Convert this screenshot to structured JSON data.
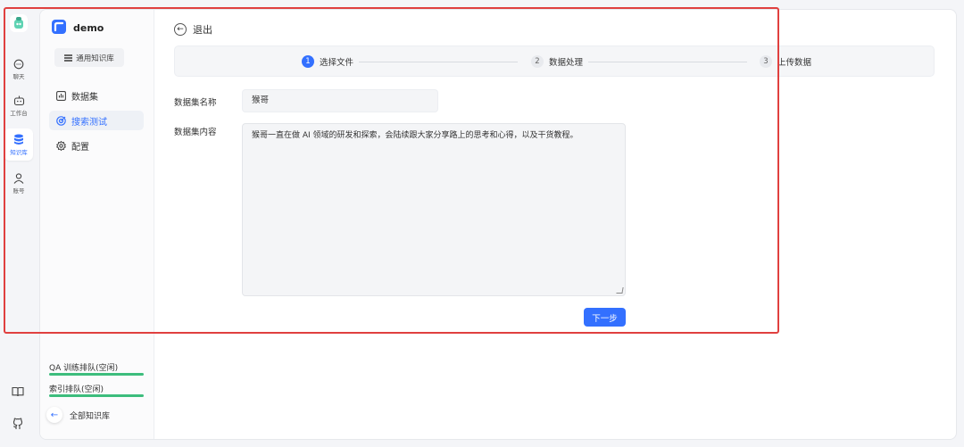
{
  "rail": {
    "items": [
      {
        "label": "聊天",
        "icon": "chat-icon"
      },
      {
        "label": "工作台",
        "icon": "robot-icon"
      },
      {
        "label": "知识库",
        "icon": "database-icon"
      },
      {
        "label": "账号",
        "icon": "user-icon"
      }
    ],
    "bottom_icons": [
      "book-icon",
      "github-icon"
    ]
  },
  "sidebar": {
    "app_name": "demo",
    "kb_type": "通用知识库",
    "nav": [
      {
        "label": "数据集",
        "icon": "chart-icon"
      },
      {
        "label": "搜索测试",
        "icon": "target-icon"
      },
      {
        "label": "配置",
        "icon": "gear-icon"
      }
    ],
    "queues": [
      "QA 训练排队(空闲)",
      "索引排队(空闲)"
    ],
    "back_label": "全部知识库"
  },
  "main": {
    "exit_label": "退出",
    "steps": [
      {
        "num": "1",
        "label": "选择文件"
      },
      {
        "num": "2",
        "label": "数据处理"
      },
      {
        "num": "3",
        "label": "上传数据"
      }
    ],
    "name_label": "数据集名称",
    "name_value": "猴哥",
    "content_label": "数据集内容",
    "content_value": "猴哥一直在做 AI 领域的研发和探索，会陆续跟大家分享路上的思考和心得，以及干货教程。",
    "next_label": "下一步"
  },
  "colors": {
    "accent": "#3370ff",
    "highlight": "#e0403f",
    "queue_bar": "#3dbd7d"
  }
}
